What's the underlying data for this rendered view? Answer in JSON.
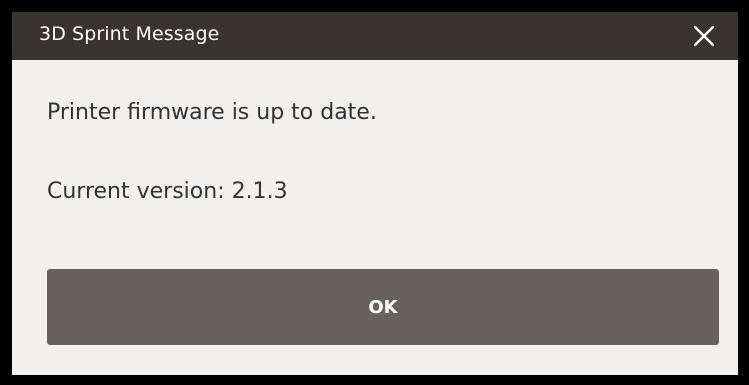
{
  "dialog": {
    "title": "3D Sprint Message",
    "close_icon": "close-icon",
    "message_line1": "Printer firmware is up to date.",
    "message_line2": "Current version:  2.1.3",
    "ok_label": "OK"
  },
  "colors": {
    "titlebar": "#393431",
    "body": "#f1f0ef",
    "button": "#67625f",
    "text": "#333333"
  }
}
